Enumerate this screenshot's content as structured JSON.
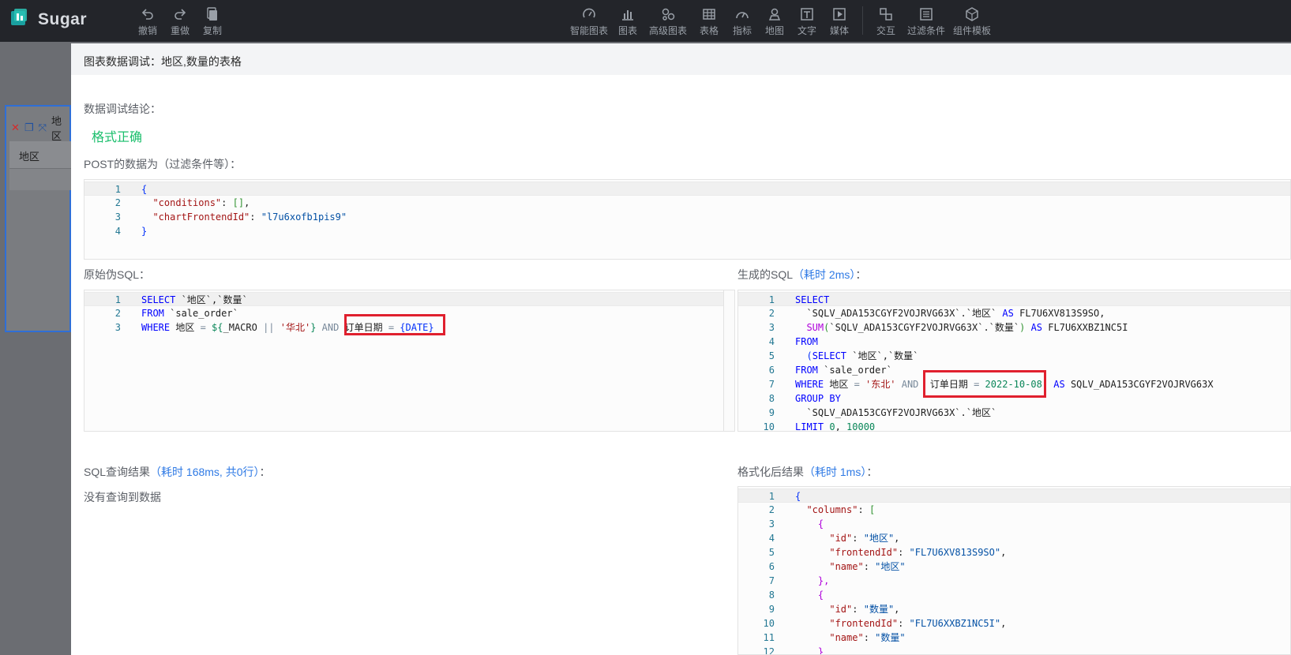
{
  "app": {
    "name": "Sugar"
  },
  "toolbar": {
    "left": [
      {
        "label": "撤销",
        "icon": "undo-icon"
      },
      {
        "label": "重做",
        "icon": "redo-icon"
      },
      {
        "label": "复制",
        "icon": "copy-icon"
      }
    ],
    "center": [
      {
        "label": "智能图表",
        "icon": "smart-chart-icon"
      },
      {
        "label": "图表",
        "icon": "bar-chart-icon"
      },
      {
        "label": "高级图表",
        "icon": "advanced-chart-icon"
      },
      {
        "label": "表格",
        "icon": "table-icon"
      },
      {
        "label": "指标",
        "icon": "gauge-icon"
      },
      {
        "label": "地图",
        "icon": "map-pin-icon"
      },
      {
        "label": "文字",
        "icon": "text-icon"
      },
      {
        "label": "媒体",
        "icon": "media-icon"
      },
      {
        "label": "交互",
        "icon": "interaction-icon"
      },
      {
        "label": "过滤条件",
        "icon": "filter-icon"
      },
      {
        "label": "组件模板",
        "icon": "template-icon"
      }
    ]
  },
  "background_widget": {
    "title": "地区",
    "column_header": "地区"
  },
  "modal": {
    "title": "图表数据调试：地区,数量的表格",
    "conclusion_label": "数据调试结论：",
    "conclusion_value": "格式正确",
    "post_label": "POST的数据为（过滤条件等）：",
    "post_code": {
      "l1": "1",
      "l2": "2",
      "l3": "3",
      "l4": "4",
      "open": "{",
      "k1": "\"conditions\"",
      "v1": "[]",
      "k2": "\"chartFrontendId\"",
      "v2": "\"l7u6xofb1pis9\"",
      "close": "}"
    },
    "raw_sql_label": "原始伪SQL：",
    "raw_sql": {
      "n1": "1",
      "n2": "2",
      "n3": "3",
      "select": "SELECT",
      "select_cols": " `地区`,`数量`",
      "from": "FROM",
      "from_table": " `sale_order`",
      "where": "WHERE",
      "where_field": " 地区 ",
      "eq": "=",
      "macro_open": " ${",
      "macro_name": "_MACRO ",
      "pipes": "||",
      "macro_str": " '华北'",
      "macro_close": "} ",
      "and": "AND",
      "date_field": " 订单日期 ",
      "eq2": "=",
      "date_macro": " {DATE}"
    },
    "gen_sql_label": "生成的SQL",
    "gen_sql_time": "（耗时 2ms）",
    "gen_sql_colon": "：",
    "gen_sql": {
      "n": [
        "1",
        "2",
        "3",
        "4",
        "5",
        "6",
        "7",
        "8",
        "9",
        "10"
      ],
      "l1": "SELECT",
      "l2a": "  `SQLV_ADA153CGYF2VOJRVG63X`.`地区` ",
      "l2b": "AS",
      "l2c": " FL7U6XV813S9SO,",
      "l3a": "  ",
      "l3b": "SUM",
      "l3c": "(",
      "l3d": "`SQLV_ADA153CGYF2VOJRVG63X`.`数量`",
      "l3e": ")",
      "l3f": " AS",
      "l3g": " FL7U6XXBZ1NC5I",
      "l4": "FROM",
      "l5a": "  (",
      "l5b": "SELECT",
      "l5c": " `地区`,`数量`",
      "l6a": "FROM",
      "l6b": " `sale_order`",
      "l7a": "WHERE",
      "l7b": " 地区 ",
      "l7c": "=",
      "l7d": " '东北'",
      "l7e": " AND",
      "l7f": "  订单日期 ",
      "l7g": "=",
      "l7h": " 2022-10-08",
      "l7i": ")",
      "l7j": " AS",
      "l7k": " SQLV_ADA153CGYF2VOJRVG63X",
      "l8": "GROUP BY",
      "l9": "  `SQLV_ADA153CGYF2VOJRVG63X`.`地区`",
      "l10a": "LIMIT",
      "l10b": " 0",
      "l10c": ",",
      "l10d": " 10000"
    },
    "result_label": "SQL查询结果",
    "result_time": "（耗时 168ms, 共0行）",
    "result_colon": "：",
    "no_data": "没有查询到数据",
    "format_label": "格式化后结果",
    "format_time": "（耗时 1ms）",
    "format_colon": "：",
    "format_json": {
      "n": [
        "1",
        "2",
        "3",
        "4",
        "5",
        "6",
        "7",
        "8",
        "9",
        "10",
        "11",
        "12"
      ],
      "open": "{",
      "columns_key": "\"columns\"",
      "columns_open": "[",
      "obj_open": "{",
      "obj_close": "},",
      "obj_close_last": "}",
      "id_key": "\"id\"",
      "fid_key": "\"frontendId\"",
      "name_key": "\"name\"",
      "id1": "\"地区\"",
      "fid1": "\"FL7U6XV813S9SO\"",
      "name1": "\"地区\"",
      "id2": "\"数量\"",
      "fid2": "\"FL7U6XXBZ1NC5I\"",
      "name2": "\"数量\""
    }
  }
}
